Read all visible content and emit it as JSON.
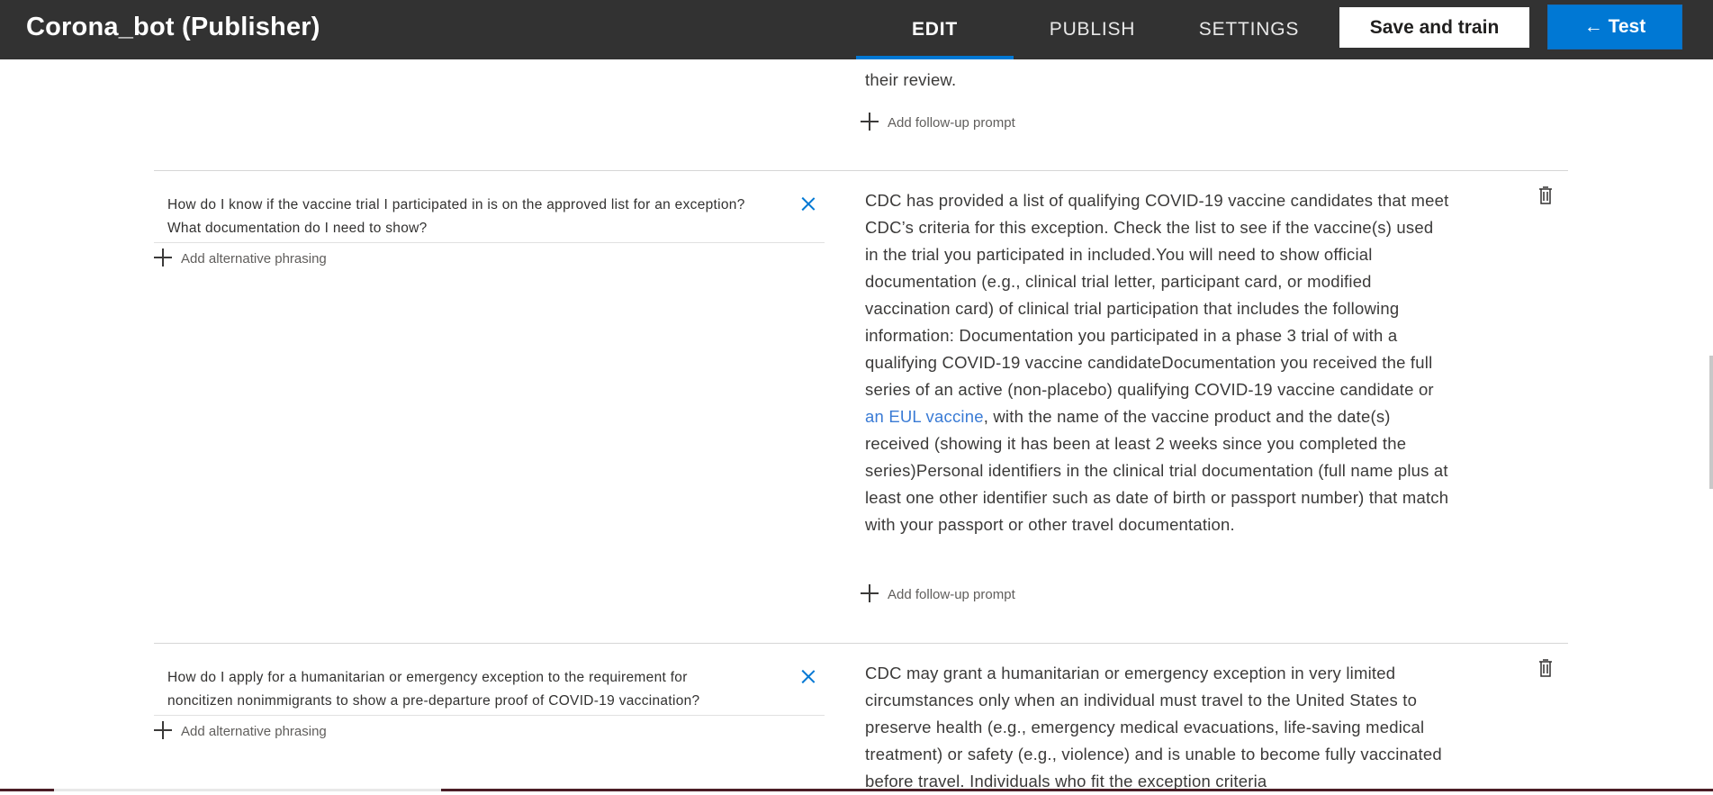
{
  "app": {
    "title": "Corona_bot (Publisher)"
  },
  "nav": {
    "tabs": [
      {
        "label": "EDIT",
        "active": true
      },
      {
        "label": "PUBLISH",
        "active": false
      },
      {
        "label": "SETTINGS",
        "active": false
      }
    ],
    "save_label": "Save and train",
    "test_label": "← Test"
  },
  "qna": [
    {
      "answer_tail": "their review.",
      "follow_up_label": "Add follow-up prompt"
    },
    {
      "question_line1": "How do I know if the vaccine trial I participated in is on the approved list for an exception?",
      "question_line2": "What documentation do I need to show?",
      "alt_label": "Add alternative phrasing",
      "answer_before_link": "CDC has provided a list of qualifying COVID-19 vaccine candidates that meet CDC’s criteria for this exception. Check the list to see if the vaccine(s) used in the trial you participated in included.You will need to show official documentation (e.g., clinical trial letter, participant card, or modified vaccination card) of clinical trial participation that includes the following information: Documentation you participated in a phase 3 trial of with a qualifying COVID-19 vaccine candidateDocumentation you received the full series of an active (non-placebo) qualifying COVID-19 vaccine candidate or ",
      "answer_link": "an EUL vaccine",
      "answer_after_link": ", with the name of the vaccine product and the date(s) received (showing it has been at least 2 weeks since you completed the series)Personal identifiers in the clinical trial documentation (full name plus at least one other identifier such as date of birth or passport number) that match with your passport or other travel documentation.",
      "follow_up_label": "Add follow-up prompt"
    },
    {
      "question_line1": "How do I apply for a humanitarian or emergency exception to the requirement for",
      "question_line2": "noncitizen nonimmigrants to show a pre-departure proof of COVID-19 vaccination?",
      "alt_label": "Add alternative phrasing",
      "answer": "CDC may grant a humanitarian or emergency exception in very limited circumstances only when an individual must travel to the United States to preserve health (e.g., emergency medical evacuations, life-saving medical treatment) or safety (e.g., violence) and is unable to become fully vaccinated before travel. Individuals who fit the exception criteria"
    }
  ],
  "colors": {
    "topbar": "#323232",
    "accent": "#0078d4",
    "link": "#3a7bd5"
  }
}
